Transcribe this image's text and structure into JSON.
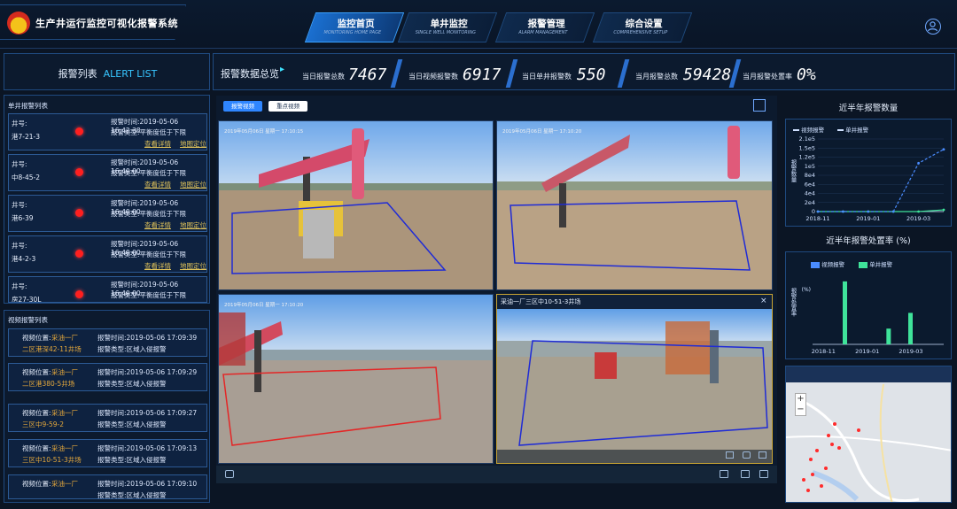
{
  "header": {
    "title": "生产井运行监控可视化报警系统",
    "nav": [
      {
        "label": "监控首页",
        "sub": "MONITORING HOME PAGE",
        "active": true
      },
      {
        "label": "单井监控",
        "sub": "SINGLE WELL MONITORING",
        "active": false
      },
      {
        "label": "报警管理",
        "sub": "ALARM MANAGEMENT",
        "active": false
      },
      {
        "label": "综合设置",
        "sub": "COMPREHENSIVE SETUP",
        "active": false
      }
    ]
  },
  "alert_panel": {
    "title_cn": "报警列表",
    "title_en": "ALERT LIST"
  },
  "single_well": {
    "section_title": "单井报警列表",
    "well_label": "井号:",
    "time_label": "报警时间:",
    "type_label": "报警类型:",
    "view_detail": "查看详情",
    "locate": "地图定位",
    "items": [
      {
        "well": "港7-21-3",
        "time": "2019-05-06 16:42:38",
        "type": "平衡度低于下限"
      },
      {
        "well": "中8-45-2",
        "time": "2019-05-06 16:40:00",
        "type": "平衡度低于下限"
      },
      {
        "well": "港6-39",
        "time": "2019-05-06 16:40:00",
        "type": "平衡度低于下限"
      },
      {
        "well": "港4-2-3",
        "time": "2019-05-06 16:40:00",
        "type": "平衡度低于下限"
      },
      {
        "well": "房27-30L",
        "time": "2019-05-06 16:40:00",
        "type": "平衡度低于下限"
      }
    ]
  },
  "video_alarm": {
    "section_title": "视频报警列表",
    "loc_label": "视频位置:",
    "time_label": "报警时间:",
    "type_label": "报警类型:",
    "items": [
      {
        "loc1": "采油一厂",
        "loc2": "二区港深42-11井场",
        "time": "2019-05-06 17:09:39",
        "type": "区域入侵报警"
      },
      {
        "loc1": "采油一厂",
        "loc2": "二区港380-5井场",
        "time": "2019-05-06 17:09:29",
        "type": "区域入侵报警"
      },
      {
        "loc1": "采油一厂",
        "loc2": "三区中9-59-2",
        "time": "2019-05-06 17:09:27",
        "type": "区域入侵报警"
      },
      {
        "loc1": "采油一厂",
        "loc2": "三区中10-51-3井场",
        "time": "2019-05-06 17:09:13",
        "type": "区域入侵报警"
      },
      {
        "loc1": "采油一厂",
        "loc2": "",
        "time": "2019-05-06 17:09:10",
        "type": "区域入侵报警"
      }
    ]
  },
  "stats": {
    "title": "报警数据总览",
    "items": [
      {
        "label": "当日报警总数",
        "value": "7467"
      },
      {
        "label": "当日视频报警数",
        "value": "6917"
      },
      {
        "label": "当日单井报警数",
        "value": "550"
      },
      {
        "label": "当月报警总数",
        "value": "59428"
      },
      {
        "label": "当月报警处置率",
        "value": "0%"
      }
    ]
  },
  "video": {
    "btn_alarm": "报警视频",
    "btn_key": "重点视频",
    "cams": [
      {
        "osd": "2019年05月06日 星期一 17:10:15",
        "caption": ""
      },
      {
        "osd": "2019年05月06日 星期一 17:10:20",
        "caption": ""
      },
      {
        "osd": "2019年05月06日 星期一 17:10:20",
        "caption": ""
      },
      {
        "osd": "",
        "caption": "采油一厂三区中10-51-3井场"
      }
    ]
  },
  "chart_data": [
    {
      "type": "line",
      "title": "近半年报警数量",
      "ylabel": "报警数量",
      "series": [
        {
          "name": "视频报警",
          "values": [
            0,
            0,
            0,
            0,
            0,
            5000
          ]
        },
        {
          "name": "单井报警",
          "values": [
            0,
            0,
            0,
            0,
            140000,
            180000
          ]
        }
      ],
      "categories": [
        "2018-11",
        "2018-12",
        "2019-01",
        "2019-02",
        "2019-03",
        "2019-04"
      ],
      "x_tick_labels": [
        "2018-11",
        "2019-01",
        "2019-03"
      ],
      "ylim": [
        0,
        210000
      ],
      "y_tick_labels": [
        "0",
        "2e4",
        "4e4",
        "6e4",
        "8e4",
        "1e5",
        "1.2e5",
        "1.5e5",
        "2.1e5"
      ]
    },
    {
      "type": "bar",
      "title": "近半年报警处置率 (%)",
      "ylabel": "报警处置率",
      "series": [
        {
          "name": "视频报警",
          "values": [
            0,
            0,
            0,
            0,
            0,
            0
          ]
        },
        {
          "name": "单井报警",
          "values": [
            0,
            4,
            0,
            1,
            2,
            0
          ]
        }
      ],
      "categories": [
        "2018-11",
        "2018-12",
        "2019-01",
        "2019-02",
        "2019-03",
        "2019-04"
      ],
      "x_tick_labels": [
        "2018-11",
        "2019-01",
        "2019-03"
      ],
      "ylim": [
        0,
        4.5
      ],
      "y_tick_labels": [
        "(%)"
      ]
    }
  ],
  "map": {
    "zoom_in": "+",
    "zoom_out": "−"
  },
  "colors": {
    "accent": "#2f86ff",
    "video": "#4a8cff",
    "single": "#3fe39a",
    "alert": "#ff1f1f"
  }
}
